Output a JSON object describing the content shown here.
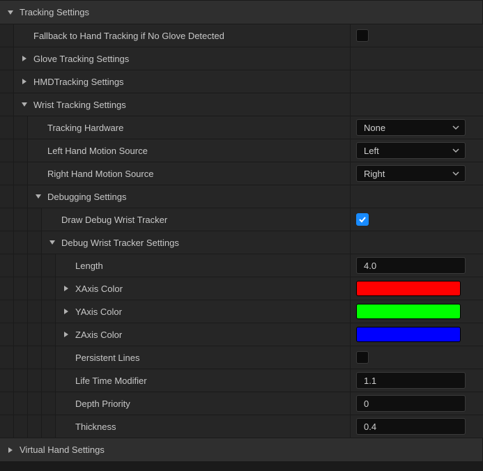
{
  "tracking": {
    "title": "Tracking Settings",
    "fallback_label": "Fallback to Hand Tracking if No Glove Detected",
    "fallback_checked": false,
    "glove_label": "Glove Tracking Settings",
    "hmd_label": "HMDTracking Settings",
    "wrist": {
      "title": "Wrist Tracking Settings",
      "hardware_label": "Tracking Hardware",
      "hardware_value": "None",
      "left_source_label": "Left Hand Motion Source",
      "left_source_value": "Left",
      "right_source_label": "Right Hand Motion Source",
      "right_source_value": "Right",
      "debugging": {
        "title": "Debugging Settings",
        "draw_label": "Draw Debug Wrist Tracker",
        "draw_checked": true,
        "settings": {
          "title": "Debug Wrist Tracker Settings",
          "length_label": "Length",
          "length_value": "4.0",
          "xaxis_label": "XAxis Color",
          "xaxis_color": "#ff0000",
          "yaxis_label": "YAxis Color",
          "yaxis_color": "#00ff00",
          "zaxis_label": "ZAxis Color",
          "zaxis_color": "#0000ff",
          "persistent_label": "Persistent Lines",
          "persistent_checked": false,
          "lifetime_label": "Life Time Modifier",
          "lifetime_value": "1.1",
          "depth_label": "Depth Priority",
          "depth_value": "0",
          "thickness_label": "Thickness",
          "thickness_value": "0.4"
        }
      }
    }
  },
  "virtual_hand": {
    "title": "Virtual Hand Settings"
  }
}
